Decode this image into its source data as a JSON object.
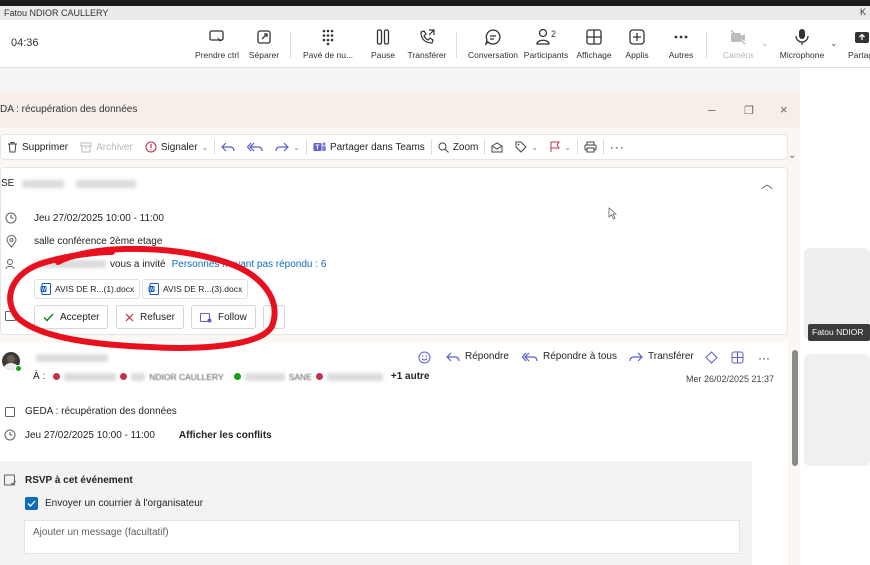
{
  "window": {
    "title_strip": "Fatou  NDIOR  CAULLERY",
    "title_strip_right": "K"
  },
  "call": {
    "timer": "04:36",
    "buttons": [
      {
        "label": "Prendre ctrl",
        "icon": "take-control-icon"
      },
      {
        "label": "Séparer",
        "icon": "popout-icon"
      },
      {
        "label": "Pavé de nu...",
        "icon": "dialpad-icon"
      },
      {
        "label": "Pause",
        "icon": "pause-icon"
      },
      {
        "label": "Transférer",
        "icon": "transfer-call-icon"
      },
      {
        "label": "Conversation",
        "icon": "chat-icon"
      },
      {
        "label": "Participants",
        "icon": "participants-icon",
        "badge": "2"
      },
      {
        "label": "Affichage",
        "icon": "view-grid-icon"
      },
      {
        "label": "Applis",
        "icon": "apps-plus-icon"
      },
      {
        "label": "Autres",
        "icon": "more-icon"
      },
      {
        "label": "Caméra",
        "icon": "camera-off-icon",
        "disabled": true
      },
      {
        "label": "Microphone",
        "icon": "microphone-icon"
      },
      {
        "label": "Partag",
        "icon": "share-icon"
      }
    ]
  },
  "outlook": {
    "window_title": "DA : récupération des données",
    "toolbar": {
      "delete": "Supprimer",
      "archive": "Archiver",
      "report": "Signaler",
      "share_teams": "Partager dans Teams",
      "zoom": "Zoom"
    },
    "event": {
      "subject_partial": "SE",
      "date": "Jeu 27/02/2025 10:00 - 11:00",
      "location": "salle conférence 2ème etage",
      "invited_text": "vous a invité",
      "no_response": "Personnes n'ayant pas répondu : 6",
      "attachments": [
        "AVIS DE R...(1).docx",
        "AVIS DE R...(3).docx"
      ],
      "accept": "Accepter",
      "decline": "Refuser",
      "follow": "Follow"
    },
    "message": {
      "reply": "Répondre",
      "reply_all": "Répondre à tous",
      "forward": "Transférer",
      "to_label": "À :",
      "recipients_partial": [
        "NDIOR  CAULLERY",
        "SANE"
      ],
      "more_recipients": "+1 autre",
      "date": "Mer 26/02/2025 21:37",
      "meeting_title": "GEDA : récupération des données",
      "meeting_date": "Jeu 27/02/2025 10:00 - 11:00",
      "show_conflicts": "Afficher les conflits",
      "rsvp_heading": "RSVP à cet événement",
      "send_email_label": "Envoyer un courrier à l'organisateur",
      "send_email_checked": true,
      "message_placeholder": "Ajouter un message (facultatif)"
    }
  },
  "side": {
    "participant_name": "Fatou  NDIOR"
  },
  "colors": {
    "annotation": "#e8101e",
    "accent": "#0f6cbd",
    "teams_purple": "#5b5fc7"
  }
}
